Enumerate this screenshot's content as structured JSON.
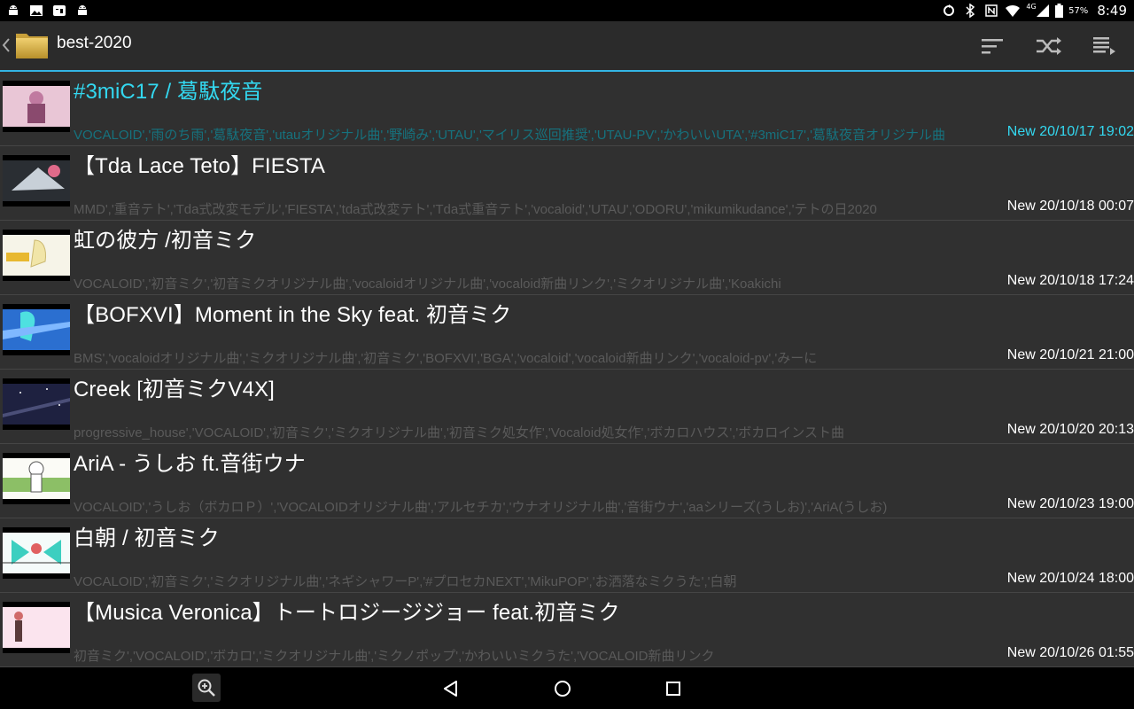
{
  "status_bar": {
    "left_icons": [
      "android-icon",
      "image-icon",
      "youtube-icon",
      "android-icon"
    ],
    "right_icons": [
      "sync-icon",
      "bluetooth-icon",
      "nfc-icon",
      "wifi-icon",
      "signal-4g-icon",
      "battery-icon"
    ],
    "network": "4G",
    "battery": "57%",
    "time": "8:49"
  },
  "action_bar": {
    "title": "best-2020",
    "actions": [
      "sort-icon",
      "shuffle-icon",
      "playlist-icon"
    ]
  },
  "colors": {
    "accent": "#33b5e5",
    "active_text": "#33d8f0",
    "background": "#303030"
  },
  "items": [
    {
      "title": "#3miC17 / 葛駄夜音",
      "tags": "VOCALOID','雨のち雨','葛駄夜音','utauオリジナル曲','野崎み','UTAU','マイリス巡回推奨','UTAU-PV','かわいいUTA','#3miC17','葛駄夜音オリジナル曲",
      "date": "New 20/10/17 19:02"
    },
    {
      "title": "【Tda Lace Teto】FIESTA",
      "tags": "MMD','重音テト','Tda式改変モデル','FIESTA','tda式改変テト','Tda式重音テト','vocaloid','UTAU','ODORU','mikumikudance','テトの日2020",
      "date": "New 20/10/18 00:07"
    },
    {
      "title": "虹の彼方 /初音ミク",
      "tags": "VOCALOID','初音ミク','初音ミクオリジナル曲','vocaloidオリジナル曲','vocaloid新曲リンク','ミクオリジナル曲','Koakichi",
      "date": "New 20/10/18 17:24"
    },
    {
      "title": "【BOFXVI】Moment in the Sky feat. 初音ミク",
      "tags": "BMS','vocaloidオリジナル曲','ミクオリジナル曲','初音ミク','BOFXVI','BGA','vocaloid','vocaloid新曲リンク','vocaloid-pv','みーに",
      "date": "New 20/10/21 21:00"
    },
    {
      "title": "Creek [初音ミクV4X]",
      "tags": "progressive_house','VOCALOID','初音ミク','ミクオリジナル曲','初音ミク処女作','Vocaloid処女作','ボカロハウス','ボカロインスト曲",
      "date": "New 20/10/20 20:13"
    },
    {
      "title": "AriA - うしお ft.音街ウナ",
      "tags": "VOCALOID','うしお（ボカロＰ）','VOCALOIDオリジナル曲','アルセチカ','ウナオリジナル曲','音街ウナ','aaシリーズ(うしお)','AriA(うしお)",
      "date": "New 20/10/23 19:00"
    },
    {
      "title": "白朝 / 初音ミク",
      "tags": "VOCALOID','初音ミク','ミクオリジナル曲','ネギシャワーP','#プロセカNEXT','MikuPOP','お洒落なミクうた','白朝",
      "date": "New 20/10/24 18:00"
    },
    {
      "title": "【Musica Veronica】トートロジージジョー feat.初音ミク",
      "tags": "初音ミク','VOCALOID','ボカロ','ミクオリジナル曲','ミクノポップ','かわいいミクうた','VOCALOID新曲リンク",
      "date": "New 20/10/26 01:55"
    }
  ],
  "nav_bar": {
    "buttons": [
      "zoom-in-icon",
      "back-icon",
      "home-icon",
      "recents-icon"
    ]
  }
}
